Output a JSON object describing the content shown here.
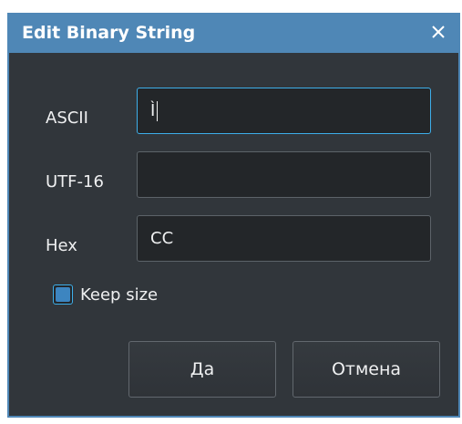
{
  "dialog": {
    "title": "Edit Binary String",
    "close_symbol": "✕"
  },
  "fields": {
    "ascii_label": "ASCII",
    "ascii_value": "Ì",
    "utf16_label": "UTF-16",
    "utf16_value": "",
    "hex_label": "Hex",
    "hex_value": "CC"
  },
  "options": {
    "keep_size_label": "Keep size",
    "keep_size_checked": true
  },
  "buttons": {
    "ok_label": "Да",
    "cancel_label": "Отмена"
  },
  "colors": {
    "titlebar": "#4f87b6",
    "window_bg": "#31363b",
    "field_bg": "#232629",
    "focus_border": "#3daee9",
    "checkbox_fill": "#3d85c0"
  },
  "icons": {
    "close": "close-icon",
    "checkbox": "checkbox-checked-icon"
  }
}
